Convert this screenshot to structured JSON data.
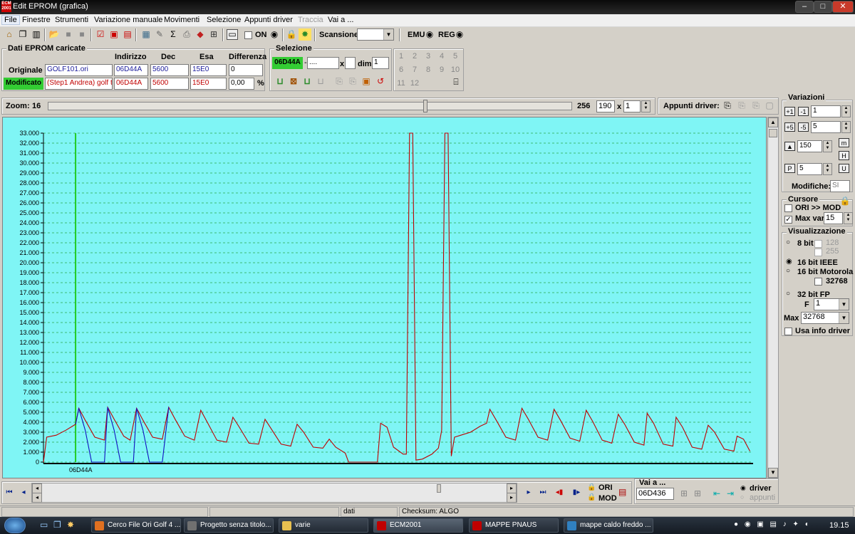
{
  "window": {
    "title": "Edit EPROM (grafica)",
    "app_icon": "ecm-icon",
    "controls": {
      "minimize": "–",
      "maximize": "□",
      "close": "✕"
    }
  },
  "menu": [
    "File",
    "Finestre",
    "Strumenti",
    "Variazione manuale",
    "Movimenti",
    "Selezione",
    "Appunti driver",
    "Traccia",
    "Vai a ..."
  ],
  "toolbar": {
    "on_label": "ON",
    "scan_label": "Scansione",
    "scan_value": "",
    "emu_label": "EMU",
    "reg_label": "REG"
  },
  "eprom": {
    "group_label": "Dati EPROM caricate",
    "headers": [
      "Indirizzo",
      "Dec",
      "Esa",
      "Differenza"
    ],
    "original": {
      "label": "Originale",
      "file": "GOLF101.ori",
      "address": "06D44A",
      "dec": "5600",
      "hex": "15E0",
      "diff": "0"
    },
    "modified": {
      "label": "Modificato",
      "file": "(Step1 Andrea) golf tdi",
      "address": "06D44A",
      "dec": "5600",
      "hex": "15E0",
      "diff": "0,00",
      "diff_unit": "%"
    }
  },
  "selection": {
    "group_label": "Selezione",
    "address": "06D44A",
    "sep": "-",
    "end": "....",
    "x_label": "x",
    "dim_label": "dim.",
    "dim_value": "1",
    "numbers": [
      "1",
      "2",
      "3",
      "4",
      "5",
      "6",
      "7",
      "8",
      "9",
      "10",
      "11",
      "12"
    ]
  },
  "zoom": {
    "label": "Zoom:",
    "min": "16",
    "max": "256",
    "value": "190",
    "x_label": "x",
    "factor": "1",
    "level": 0.72
  },
  "appunti": {
    "label": "Appunti driver:"
  },
  "variazioni": {
    "label": "Variazioni",
    "v1": "1",
    "v2": "5",
    "v3": "150",
    "v4": "5",
    "modifiche_label": "Modifiche:",
    "modifiche_value": "SI"
  },
  "cursore": {
    "label": "Cursore",
    "ori_mod": "ORI >> MOD",
    "ori_mod_checked": false,
    "max_var": "Max var",
    "max_var_checked": true,
    "max_var_value": "15"
  },
  "visualizzazione": {
    "label": "Visualizzazione",
    "bit8": "8 bit",
    "c128": "128",
    "c255": "255",
    "ieee": "16 bit IEEE",
    "motorola": "16 bit Motorola",
    "m32768": "32768",
    "fp32": "32 bit FP",
    "f_label": "F",
    "f_value": "1",
    "max_label": "Max",
    "max_value": "32768",
    "usa_info": "Usa info driver",
    "selected": "16 bit IEEE"
  },
  "vai_a": {
    "label": "Vai a ...",
    "value": "06D436",
    "driver": "driver",
    "appunti": "appunti",
    "selected": "driver"
  },
  "bottom_buttons": {
    "ori": "ORI",
    "mod": "MOD"
  },
  "status": {
    "seg1": "",
    "seg2": "",
    "seg3": "dati",
    "seg4": "Checksum: ALGO"
  },
  "taskbar": {
    "items": [
      {
        "label": "Cerco File Ori Golf 4 ...",
        "color": "#e07020"
      },
      {
        "label": "Progetto senza titolo...",
        "color": "#707070"
      },
      {
        "label": "varie",
        "color": "#e8c050"
      },
      {
        "label": "ECM2001",
        "color": "#c00000"
      },
      {
        "label": "MAPPE PNAUS",
        "color": "#c00000"
      },
      {
        "label": "mappe caldo freddo ...",
        "color": "#3080c0"
      }
    ],
    "clock": "19.15"
  },
  "chart_data": {
    "type": "line",
    "title": "",
    "xlabel": "",
    "ylabel": "",
    "ylim": [
      0,
      33000
    ],
    "yticks": [
      "0",
      "1.000",
      "2.000",
      "3.000",
      "4.000",
      "5.000",
      "6.000",
      "7.000",
      "8.000",
      "9.000",
      "10.000",
      "11.000",
      "12.000",
      "13.000",
      "14.000",
      "15.000",
      "16.000",
      "17.000",
      "18.000",
      "19.000",
      "20.000",
      "21.000",
      "22.000",
      "23.000",
      "24.000",
      "25.000",
      "26.000",
      "27.000",
      "28.000",
      "29.000",
      "30.000",
      "31.000",
      "32.000",
      "33.000"
    ],
    "x_start_label": "06D44A",
    "xlim": [
      0,
      200
    ],
    "cursor_x": 10,
    "grid": true,
    "series": [
      {
        "color": "#c00000",
        "points": [
          [
            0,
            0
          ],
          [
            1,
            2500
          ],
          [
            4,
            2700
          ],
          [
            7,
            3200
          ],
          [
            9,
            3600
          ],
          [
            10,
            3800
          ],
          [
            11,
            5400
          ],
          [
            13,
            4200
          ],
          [
            16,
            2500
          ],
          [
            19,
            2200
          ],
          [
            20,
            5500
          ],
          [
            22,
            4300
          ],
          [
            25,
            2600
          ],
          [
            27,
            2200
          ],
          [
            29,
            5400
          ],
          [
            31,
            4200
          ],
          [
            34,
            2500
          ],
          [
            37,
            2300
          ],
          [
            39,
            5500
          ],
          [
            41,
            4300
          ],
          [
            44,
            2600
          ],
          [
            47,
            2200
          ],
          [
            49,
            5200
          ],
          [
            51,
            4000
          ],
          [
            54,
            2200
          ],
          [
            57,
            2000
          ],
          [
            59,
            4500
          ],
          [
            61,
            3500
          ],
          [
            64,
            1900
          ],
          [
            67,
            1800
          ],
          [
            69,
            4300
          ],
          [
            71,
            3300
          ],
          [
            74,
            1800
          ],
          [
            77,
            1600
          ],
          [
            79,
            3800
          ],
          [
            81,
            3000
          ],
          [
            84,
            1500
          ],
          [
            87,
            1400
          ],
          [
            89,
            2300
          ],
          [
            91,
            1500
          ],
          [
            94,
            900
          ],
          [
            95,
            0
          ],
          [
            100,
            0
          ],
          [
            104,
            0
          ],
          [
            105,
            3900
          ],
          [
            107,
            3500
          ],
          [
            109,
            1500
          ],
          [
            112,
            800
          ],
          [
            113,
            800
          ],
          [
            114,
            33000
          ],
          [
            115,
            33000
          ],
          [
            116,
            200
          ],
          [
            118,
            300
          ],
          [
            121,
            800
          ],
          [
            123,
            1400
          ],
          [
            124,
            3200
          ],
          [
            125,
            33000
          ],
          [
            126,
            33000
          ],
          [
            127,
            600
          ],
          [
            128,
            2500
          ],
          [
            130,
            2700
          ],
          [
            133,
            3000
          ],
          [
            136,
            3600
          ],
          [
            138,
            3900
          ],
          [
            139,
            5300
          ],
          [
            141,
            4200
          ],
          [
            144,
            2500
          ],
          [
            147,
            2200
          ],
          [
            149,
            5400
          ],
          [
            151,
            4300
          ],
          [
            154,
            2500
          ],
          [
            157,
            2200
          ],
          [
            159,
            5300
          ],
          [
            161,
            4200
          ],
          [
            164,
            2400
          ],
          [
            167,
            2100
          ],
          [
            169,
            5200
          ],
          [
            171,
            4100
          ],
          [
            174,
            2200
          ],
          [
            177,
            1900
          ],
          [
            179,
            4800
          ],
          [
            181,
            3800
          ],
          [
            184,
            2000
          ],
          [
            187,
            1700
          ],
          [
            188,
            4900
          ],
          [
            190,
            3900
          ],
          [
            193,
            1800
          ],
          [
            196,
            1600
          ],
          [
            197,
            4500
          ],
          [
            199,
            3500
          ],
          [
            202,
            1500
          ],
          [
            205,
            1300
          ],
          [
            207,
            3700
          ],
          [
            209,
            3000
          ],
          [
            212,
            1300
          ],
          [
            215,
            1100
          ],
          [
            216,
            2600
          ],
          [
            218,
            2300
          ],
          [
            220,
            1100
          ]
        ]
      },
      {
        "color": "#1010c0",
        "points": [
          [
            10,
            3800
          ],
          [
            11,
            5400
          ],
          [
            13,
            3200
          ],
          [
            15,
            0
          ],
          [
            19,
            0
          ],
          [
            20,
            5500
          ],
          [
            22,
            3200
          ],
          [
            24,
            0
          ],
          [
            28,
            0
          ],
          [
            29,
            5400
          ],
          [
            31,
            3200
          ],
          [
            33,
            0
          ],
          [
            37,
            0
          ],
          [
            39,
            5500
          ]
        ]
      }
    ]
  }
}
